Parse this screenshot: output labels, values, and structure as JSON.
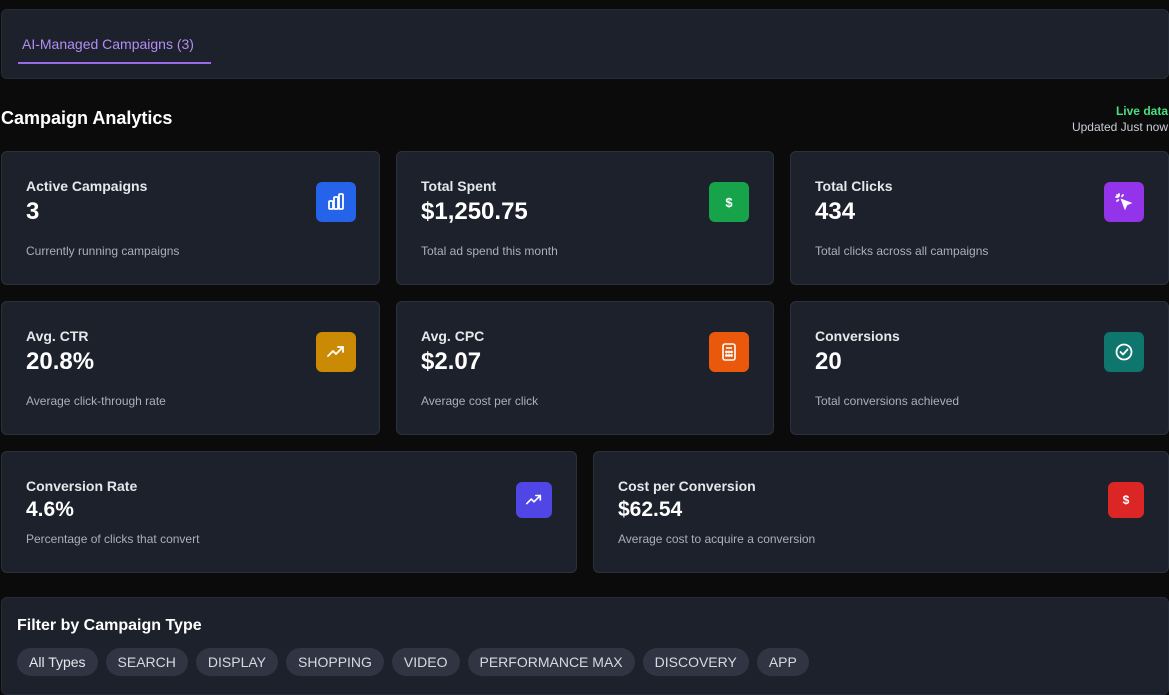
{
  "tabs": [
    {
      "label": "AI-Managed Campaigns (3)"
    }
  ],
  "header": {
    "title": "Campaign Analytics",
    "live_label": "Live data",
    "updated": "Updated Just now"
  },
  "metrics": [
    {
      "label": "Active Campaigns",
      "value": "3",
      "desc": "Currently running campaigns",
      "icon": "bar-chart-icon",
      "color": "#2563eb"
    },
    {
      "label": "Total Spent",
      "value": "$1,250.75",
      "desc": "Total ad spend this month",
      "icon": "dollar-icon",
      "color": "#16a34a"
    },
    {
      "label": "Total Clicks",
      "value": "434",
      "desc": "Total clicks across all campaigns",
      "icon": "cursor-click-icon",
      "color": "#9333ea"
    },
    {
      "label": "Avg. CTR",
      "value": "20.8%",
      "desc": "Average click-through rate",
      "icon": "trending-up-icon",
      "color": "#ca8a04"
    },
    {
      "label": "Avg. CPC",
      "value": "$2.07",
      "desc": "Average cost per click",
      "icon": "calculator-icon",
      "color": "#ea580c"
    },
    {
      "label": "Conversions",
      "value": "20",
      "desc": "Total conversions achieved",
      "icon": "check-circle-icon",
      "color": "#0f766e"
    },
    {
      "label": "Conversion Rate",
      "value": "4.6%",
      "desc": "Percentage of clicks that convert",
      "icon": "trending-up-icon",
      "color": "#4f46e5"
    },
    {
      "label": "Cost per Conversion",
      "value": "$62.54",
      "desc": "Average cost to acquire a conversion",
      "icon": "dollar-icon",
      "color": "#dc2626"
    }
  ],
  "filter": {
    "title": "Filter by Campaign Type",
    "chips": [
      "All Types",
      "SEARCH",
      "DISPLAY",
      "SHOPPING",
      "VIDEO",
      "PERFORMANCE MAX",
      "DISCOVERY",
      "APP"
    ]
  }
}
